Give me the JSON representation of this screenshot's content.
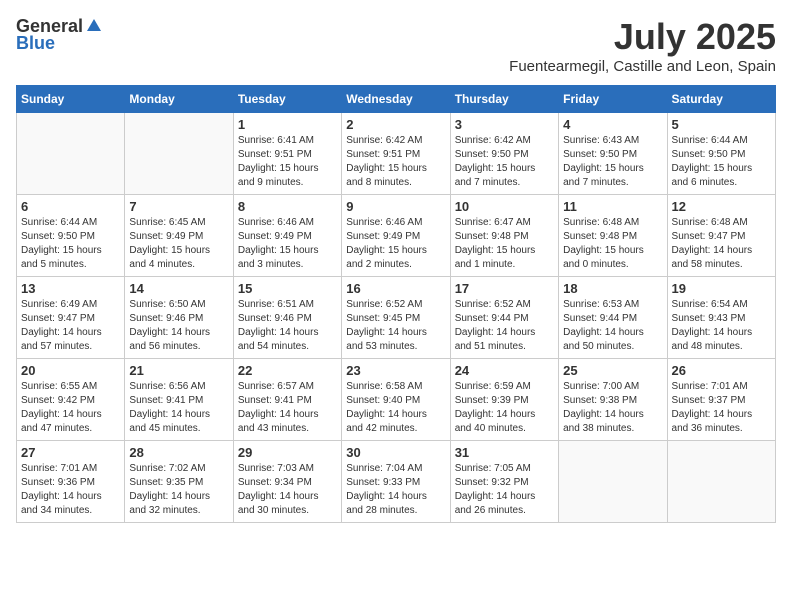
{
  "header": {
    "logo_general": "General",
    "logo_blue": "Blue",
    "month_year": "July 2025",
    "location": "Fuentearmegil, Castille and Leon, Spain"
  },
  "weekdays": [
    "Sunday",
    "Monday",
    "Tuesday",
    "Wednesday",
    "Thursday",
    "Friday",
    "Saturday"
  ],
  "weeks": [
    [
      {
        "day": "",
        "sunrise": "",
        "sunset": "",
        "daylight": ""
      },
      {
        "day": "",
        "sunrise": "",
        "sunset": "",
        "daylight": ""
      },
      {
        "day": "1",
        "sunrise": "Sunrise: 6:41 AM",
        "sunset": "Sunset: 9:51 PM",
        "daylight": "Daylight: 15 hours and 9 minutes."
      },
      {
        "day": "2",
        "sunrise": "Sunrise: 6:42 AM",
        "sunset": "Sunset: 9:51 PM",
        "daylight": "Daylight: 15 hours and 8 minutes."
      },
      {
        "day": "3",
        "sunrise": "Sunrise: 6:42 AM",
        "sunset": "Sunset: 9:50 PM",
        "daylight": "Daylight: 15 hours and 7 minutes."
      },
      {
        "day": "4",
        "sunrise": "Sunrise: 6:43 AM",
        "sunset": "Sunset: 9:50 PM",
        "daylight": "Daylight: 15 hours and 7 minutes."
      },
      {
        "day": "5",
        "sunrise": "Sunrise: 6:44 AM",
        "sunset": "Sunset: 9:50 PM",
        "daylight": "Daylight: 15 hours and 6 minutes."
      }
    ],
    [
      {
        "day": "6",
        "sunrise": "Sunrise: 6:44 AM",
        "sunset": "Sunset: 9:50 PM",
        "daylight": "Daylight: 15 hours and 5 minutes."
      },
      {
        "day": "7",
        "sunrise": "Sunrise: 6:45 AM",
        "sunset": "Sunset: 9:49 PM",
        "daylight": "Daylight: 15 hours and 4 minutes."
      },
      {
        "day": "8",
        "sunrise": "Sunrise: 6:46 AM",
        "sunset": "Sunset: 9:49 PM",
        "daylight": "Daylight: 15 hours and 3 minutes."
      },
      {
        "day": "9",
        "sunrise": "Sunrise: 6:46 AM",
        "sunset": "Sunset: 9:49 PM",
        "daylight": "Daylight: 15 hours and 2 minutes."
      },
      {
        "day": "10",
        "sunrise": "Sunrise: 6:47 AM",
        "sunset": "Sunset: 9:48 PM",
        "daylight": "Daylight: 15 hours and 1 minute."
      },
      {
        "day": "11",
        "sunrise": "Sunrise: 6:48 AM",
        "sunset": "Sunset: 9:48 PM",
        "daylight": "Daylight: 15 hours and 0 minutes."
      },
      {
        "day": "12",
        "sunrise": "Sunrise: 6:48 AM",
        "sunset": "Sunset: 9:47 PM",
        "daylight": "Daylight: 14 hours and 58 minutes."
      }
    ],
    [
      {
        "day": "13",
        "sunrise": "Sunrise: 6:49 AM",
        "sunset": "Sunset: 9:47 PM",
        "daylight": "Daylight: 14 hours and 57 minutes."
      },
      {
        "day": "14",
        "sunrise": "Sunrise: 6:50 AM",
        "sunset": "Sunset: 9:46 PM",
        "daylight": "Daylight: 14 hours and 56 minutes."
      },
      {
        "day": "15",
        "sunrise": "Sunrise: 6:51 AM",
        "sunset": "Sunset: 9:46 PM",
        "daylight": "Daylight: 14 hours and 54 minutes."
      },
      {
        "day": "16",
        "sunrise": "Sunrise: 6:52 AM",
        "sunset": "Sunset: 9:45 PM",
        "daylight": "Daylight: 14 hours and 53 minutes."
      },
      {
        "day": "17",
        "sunrise": "Sunrise: 6:52 AM",
        "sunset": "Sunset: 9:44 PM",
        "daylight": "Daylight: 14 hours and 51 minutes."
      },
      {
        "day": "18",
        "sunrise": "Sunrise: 6:53 AM",
        "sunset": "Sunset: 9:44 PM",
        "daylight": "Daylight: 14 hours and 50 minutes."
      },
      {
        "day": "19",
        "sunrise": "Sunrise: 6:54 AM",
        "sunset": "Sunset: 9:43 PM",
        "daylight": "Daylight: 14 hours and 48 minutes."
      }
    ],
    [
      {
        "day": "20",
        "sunrise": "Sunrise: 6:55 AM",
        "sunset": "Sunset: 9:42 PM",
        "daylight": "Daylight: 14 hours and 47 minutes."
      },
      {
        "day": "21",
        "sunrise": "Sunrise: 6:56 AM",
        "sunset": "Sunset: 9:41 PM",
        "daylight": "Daylight: 14 hours and 45 minutes."
      },
      {
        "day": "22",
        "sunrise": "Sunrise: 6:57 AM",
        "sunset": "Sunset: 9:41 PM",
        "daylight": "Daylight: 14 hours and 43 minutes."
      },
      {
        "day": "23",
        "sunrise": "Sunrise: 6:58 AM",
        "sunset": "Sunset: 9:40 PM",
        "daylight": "Daylight: 14 hours and 42 minutes."
      },
      {
        "day": "24",
        "sunrise": "Sunrise: 6:59 AM",
        "sunset": "Sunset: 9:39 PM",
        "daylight": "Daylight: 14 hours and 40 minutes."
      },
      {
        "day": "25",
        "sunrise": "Sunrise: 7:00 AM",
        "sunset": "Sunset: 9:38 PM",
        "daylight": "Daylight: 14 hours and 38 minutes."
      },
      {
        "day": "26",
        "sunrise": "Sunrise: 7:01 AM",
        "sunset": "Sunset: 9:37 PM",
        "daylight": "Daylight: 14 hours and 36 minutes."
      }
    ],
    [
      {
        "day": "27",
        "sunrise": "Sunrise: 7:01 AM",
        "sunset": "Sunset: 9:36 PM",
        "daylight": "Daylight: 14 hours and 34 minutes."
      },
      {
        "day": "28",
        "sunrise": "Sunrise: 7:02 AM",
        "sunset": "Sunset: 9:35 PM",
        "daylight": "Daylight: 14 hours and 32 minutes."
      },
      {
        "day": "29",
        "sunrise": "Sunrise: 7:03 AM",
        "sunset": "Sunset: 9:34 PM",
        "daylight": "Daylight: 14 hours and 30 minutes."
      },
      {
        "day": "30",
        "sunrise": "Sunrise: 7:04 AM",
        "sunset": "Sunset: 9:33 PM",
        "daylight": "Daylight: 14 hours and 28 minutes."
      },
      {
        "day": "31",
        "sunrise": "Sunrise: 7:05 AM",
        "sunset": "Sunset: 9:32 PM",
        "daylight": "Daylight: 14 hours and 26 minutes."
      },
      {
        "day": "",
        "sunrise": "",
        "sunset": "",
        "daylight": ""
      },
      {
        "day": "",
        "sunrise": "",
        "sunset": "",
        "daylight": ""
      }
    ]
  ]
}
